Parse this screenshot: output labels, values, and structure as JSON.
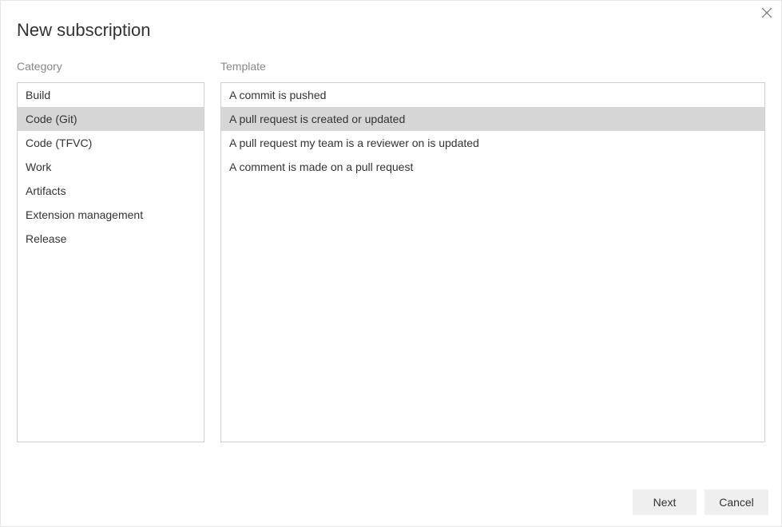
{
  "dialog": {
    "title": "New subscription"
  },
  "category": {
    "label": "Category",
    "items": [
      {
        "label": "Build",
        "selected": false
      },
      {
        "label": "Code (Git)",
        "selected": true
      },
      {
        "label": "Code (TFVC)",
        "selected": false
      },
      {
        "label": "Work",
        "selected": false
      },
      {
        "label": "Artifacts",
        "selected": false
      },
      {
        "label": "Extension management",
        "selected": false
      },
      {
        "label": "Release",
        "selected": false
      }
    ]
  },
  "template": {
    "label": "Template",
    "items": [
      {
        "label": "A commit is pushed",
        "selected": false
      },
      {
        "label": "A pull request is created or updated",
        "selected": true
      },
      {
        "label": "A pull request my team is a reviewer on is updated",
        "selected": false
      },
      {
        "label": "A comment is made on a pull request",
        "selected": false
      }
    ]
  },
  "footer": {
    "next_label": "Next",
    "cancel_label": "Cancel"
  }
}
